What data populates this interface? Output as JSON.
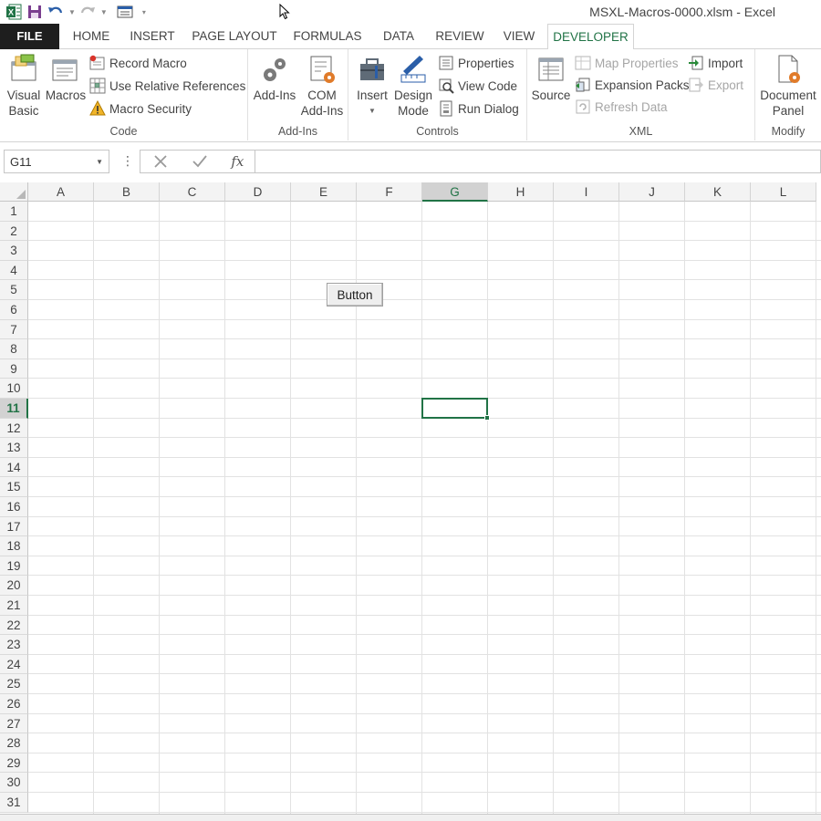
{
  "titlebar": {
    "window_title": "MSXL-Macros-0000.xlsm - Excel",
    "qat_items": [
      "excel-logo-icon",
      "save-icon",
      "undo-icon",
      "redo-icon",
      "form-icon"
    ]
  },
  "tabs": [
    {
      "label": "FILE"
    },
    {
      "label": "HOME"
    },
    {
      "label": "INSERT"
    },
    {
      "label": "PAGE LAYOUT"
    },
    {
      "label": "FORMULAS"
    },
    {
      "label": "DATA"
    },
    {
      "label": "REVIEW"
    },
    {
      "label": "VIEW"
    },
    {
      "label": "DEVELOPER",
      "active": true
    }
  ],
  "ribbon": {
    "code": {
      "label": "Code",
      "visual_basic": {
        "line1": "Visual",
        "line2": "Basic"
      },
      "macros": "Macros",
      "record_macro": "Record Macro",
      "relative_refs": "Use Relative References",
      "macro_security": "Macro Security"
    },
    "addins": {
      "label": "Add-Ins",
      "addins": "Add-Ins",
      "com_addins": {
        "line1": "COM",
        "line2": "Add-Ins"
      }
    },
    "controls": {
      "label": "Controls",
      "insert": "Insert",
      "design_mode": {
        "line1": "Design",
        "line2": "Mode"
      },
      "properties": "Properties",
      "view_code": "View Code",
      "run_dialog": "Run Dialog"
    },
    "xml": {
      "label": "XML",
      "source": "Source",
      "map_properties": "Map Properties",
      "expansion_packs": "Expansion Packs",
      "refresh_data": "Refresh Data",
      "import": "Import",
      "export": "Export"
    },
    "modify": {
      "label": "Modify",
      "document_panel": {
        "line1": "Document",
        "line2": "Panel"
      }
    }
  },
  "formula_bar": {
    "name_box": "G11",
    "separator": "⋮",
    "fx": "fx",
    "value": ""
  },
  "sheet": {
    "columns": [
      "A",
      "B",
      "C",
      "D",
      "E",
      "F",
      "G",
      "H",
      "I",
      "J",
      "K",
      "L"
    ],
    "rows": [
      "1",
      "2",
      "3",
      "4",
      "5",
      "6",
      "7",
      "8",
      "9",
      "10",
      "11",
      "12",
      "13",
      "14",
      "15",
      "16",
      "17",
      "18",
      "19",
      "20",
      "21",
      "22",
      "23",
      "24",
      "25",
      "26",
      "27",
      "28",
      "29",
      "30",
      "31"
    ],
    "selected_column": "G",
    "selected_row": "11",
    "form_button_label": "Button"
  },
  "colors": {
    "accent": "#217346",
    "file_tab": "#1e1e1e",
    "header_bg": "#f3f3f3"
  }
}
